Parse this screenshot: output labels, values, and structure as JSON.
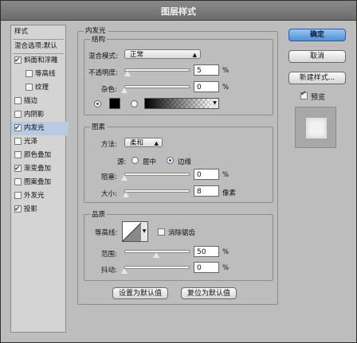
{
  "window": {
    "title": "图层样式"
  },
  "sidebar": {
    "header": "样式",
    "blend_defaults": "混合选项:默认",
    "items": [
      {
        "label": "斜面和浮雕",
        "checked": true
      },
      {
        "label": "等高线",
        "checked": false
      },
      {
        "label": "纹理",
        "checked": false
      },
      {
        "label": "描边",
        "checked": false
      },
      {
        "label": "内阴影",
        "checked": false
      },
      {
        "label": "内发光",
        "checked": true
      },
      {
        "label": "光泽",
        "checked": false
      },
      {
        "label": "颜色叠加",
        "checked": false
      },
      {
        "label": "渐变叠加",
        "checked": true
      },
      {
        "label": "图案叠加",
        "checked": false
      },
      {
        "label": "外发光",
        "checked": false
      },
      {
        "label": "投影",
        "checked": true
      }
    ]
  },
  "panel": {
    "title": "内发光",
    "structure": {
      "title": "结构",
      "blend_mode_label": "混合模式:",
      "blend_mode_value": "正常",
      "opacity_label": "不透明度:",
      "opacity_value": "5",
      "opacity_unit": "%",
      "opacity_fraction": 0.05,
      "noise_label": "杂色:",
      "noise_value": "0",
      "noise_unit": "%",
      "noise_fraction": 0.0,
      "color_swatch": "#000000"
    },
    "elements": {
      "title": "图素",
      "method_label": "方法:",
      "method_value": "柔和",
      "source_label": "源:",
      "source_center": "居中",
      "source_edge": "边缘",
      "source_selected": "edge",
      "choke_label": "阻塞:",
      "choke_value": "0",
      "choke_unit": "%",
      "choke_fraction": 0.0,
      "size_label": "大小:",
      "size_value": "8",
      "size_unit": "像素",
      "size_fraction": 0.03
    },
    "quality": {
      "title": "品质",
      "contour_label": "等高线:",
      "antialias_label": "消除锯齿",
      "antialias_checked": false,
      "range_label": "范围:",
      "range_value": "50",
      "range_unit": "%",
      "range_fraction": 0.5,
      "jitter_label": "抖动:",
      "jitter_value": "0",
      "jitter_unit": "%",
      "jitter_fraction": 0.0
    },
    "make_default": "设置为默认值",
    "reset_default": "复位为默认值"
  },
  "actions": {
    "ok": "确定",
    "cancel": "取消",
    "new_style": "新建样式...",
    "preview_label": "预览",
    "preview_checked": true
  }
}
